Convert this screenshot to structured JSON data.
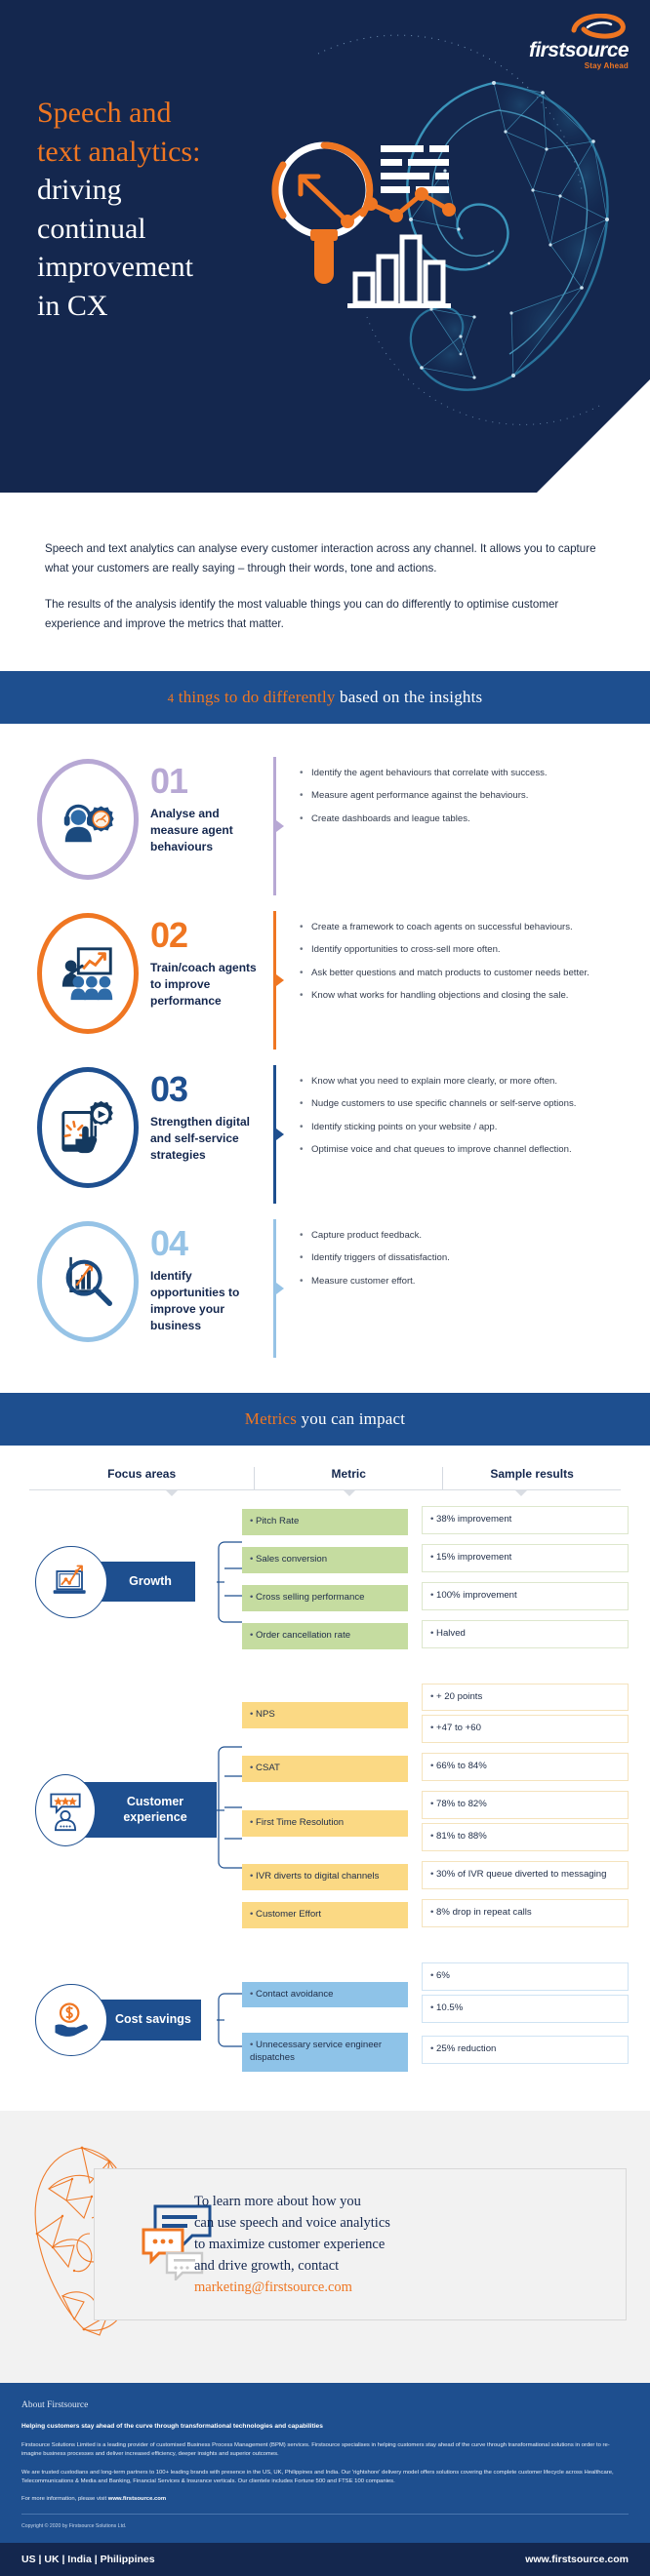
{
  "brand": {
    "logo_word": "firstsource",
    "logo_tagline": "Stay Ahead",
    "accent_orange": "#ef7622",
    "navy": "#14274e",
    "blue": "#1e4f8f"
  },
  "hero": {
    "title_line1": "Speech and",
    "title_line2": "text analytics:",
    "title_line3": "driving",
    "title_line4": "continual",
    "title_line5": "improvement",
    "title_line6": "in CX"
  },
  "intro": {
    "paragraph1": "Speech and text analytics can analyse every customer interaction across any channel. It allows you to capture what your customers are really saying – through their words, tone and actions.",
    "paragraph2": "The results of the analysis identify the most valuable things you can do differently to optimise customer experience and improve the metrics that matter."
  },
  "things_band": {
    "number": "4",
    "accent_text": " things to do differently",
    "rest_text": " based on the insights"
  },
  "steps": [
    {
      "number": "01",
      "label": "Analyse and measure agent behaviours",
      "color": "#b7a8d4",
      "icon": "agent-headset-gear-icon",
      "bullets": [
        "Identify the agent behaviours that correlate with success.",
        "Measure agent performance against the behaviours.",
        "Create dashboards and league tables."
      ]
    },
    {
      "number": "02",
      "label": "Train/coach agents to improve performance",
      "color": "#ef7622",
      "icon": "training-presentation-icon",
      "bullets": [
        "Create a framework to coach agents on successful behaviours.",
        "Identify opportunities to cross-sell more often.",
        "Ask better questions and match products to customer needs better.",
        "Know what works for handling objections and closing the sale."
      ]
    },
    {
      "number": "03",
      "label": "Strengthen digital and self-service strategies",
      "color": "#1e4f8f",
      "icon": "tablet-tap-gear-icon",
      "bullets": [
        "Know what you need to explain more clearly, or more often.",
        "Nudge customers to use specific channels or self-serve options.",
        "Identify sticking points on your website / app.",
        "Optimise voice and chat queues to improve channel deflection."
      ]
    },
    {
      "number": "04",
      "label": "Identify opportunities to improve your business",
      "color": "#96c3e6",
      "icon": "magnifier-bar-chart-icon",
      "bullets": [
        "Capture product feedback.",
        "Identify triggers of dissatisfaction.",
        "Measure customer effort."
      ]
    }
  ],
  "metrics_band": {
    "accent_text": "Metrics",
    "rest_text": " you can impact"
  },
  "metrics": {
    "headers": {
      "focus": "Focus areas",
      "metric": "Metric",
      "results": "Sample results"
    },
    "groups": [
      {
        "name": "Growth",
        "icon": "laptop-growth-chart-icon",
        "tone": "green",
        "rows": [
          {
            "metric": "Pitch Rate",
            "results": [
              "38% improvement"
            ]
          },
          {
            "metric": "Sales conversion",
            "results": [
              "15% improvement"
            ]
          },
          {
            "metric": "Cross selling performance",
            "results": [
              "100% improvement"
            ]
          },
          {
            "metric": "Order cancellation rate",
            "results": [
              "Halved"
            ]
          }
        ]
      },
      {
        "name": "Customer experience",
        "icon": "customer-rating-stars-icon",
        "tone": "yellow",
        "rows": [
          {
            "metric": "NPS",
            "results": [
              "+ 20 points",
              "+47 to +60"
            ]
          },
          {
            "metric": "CSAT",
            "results": [
              "66% to 84%"
            ]
          },
          {
            "metric": "First Time Resolution",
            "results": [
              "78% to 82%",
              "81% to 88%"
            ]
          },
          {
            "metric": "IVR diverts to digital channels",
            "results": [
              "30% of IVR queue diverted to messaging"
            ]
          },
          {
            "metric": "Customer Effort",
            "results": [
              "8% drop in repeat calls"
            ]
          }
        ]
      },
      {
        "name": "Cost savings",
        "icon": "hand-dollar-savings-icon",
        "tone": "blue",
        "rows": [
          {
            "metric": "Contact avoidance",
            "results": [
              "6%",
              "10.5%"
            ]
          },
          {
            "metric": "Unnecessary service engineer dispatches",
            "results": [
              "25% reduction"
            ]
          }
        ]
      }
    ]
  },
  "cta": {
    "line1": "To learn more about how you",
    "line2": "can use speech and voice analytics",
    "line3": "to maximize customer experience",
    "line4": "and drive growth, contact",
    "email": "marketing@firstsource.com"
  },
  "footer": {
    "title": "About Firstsource",
    "lead": "Helping customers stay ahead of the curve through transformational technologies and capabilities",
    "body1": "Firstsource Solutions Limited is a leading provider of customised Business Process Management (BPM) services.  Firstsource specialises in helping customers stay ahead of the curve through transformational solutions in order to re-imagine business processes and deliver increased efficiency, deeper insights and superior outcomes.",
    "body2": "We are trusted custodians and long-term partners to 100+ leading brands with presence in the US, UK, Philippines and India. Our 'rightshore' delivery model offers solutions covering the complete customer lifecycle across Healthcare, Telecommunications & Media and Banking, Financial Services & Insurance verticals. Our clientele includes Fortune 500 and FTSE 100 companies.",
    "visit_prefix": "For more information, please visit ",
    "visit_url": "www.firstsource.com",
    "copyright": "Copyright © 2020 by Firstsource Solutions Ltd."
  },
  "bottombar": {
    "regions": "US | UK | India | Philippines",
    "website": "www.firstsource.com"
  }
}
